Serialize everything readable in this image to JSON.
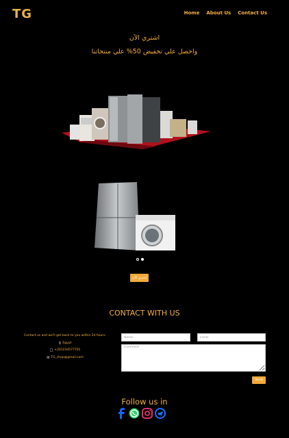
{
  "header": {
    "logo": "TG",
    "nav": [
      "Home",
      "About Us",
      "Contact Us"
    ]
  },
  "hero": {
    "line1": "اشتري الآن",
    "line2": "واحصل علي تخفيض 50% علي منتجاتنا"
  },
  "slider": {
    "dots": 2,
    "active_dot": 2,
    "buy_label": "اشتري الآن"
  },
  "contact": {
    "title": "CONTACT WITH US",
    "intro": "Contact us and we'll get back to you within 24 hours.",
    "location": "Egypt",
    "phone": "+201234577701",
    "email": "TG_shop@gmail.com",
    "name_placeholder": "Name",
    "email_placeholder": "Email",
    "comment_placeholder": "Comment",
    "send_label": "Send"
  },
  "footer": {
    "follow": "Follow us in",
    "social_icons": [
      "facebook-icon",
      "whatsapp-icon",
      "instagram-icon",
      "telegram-icon"
    ]
  },
  "colors": {
    "accent": "#f5b041",
    "button": "#f0a93a",
    "background": "#000000"
  }
}
